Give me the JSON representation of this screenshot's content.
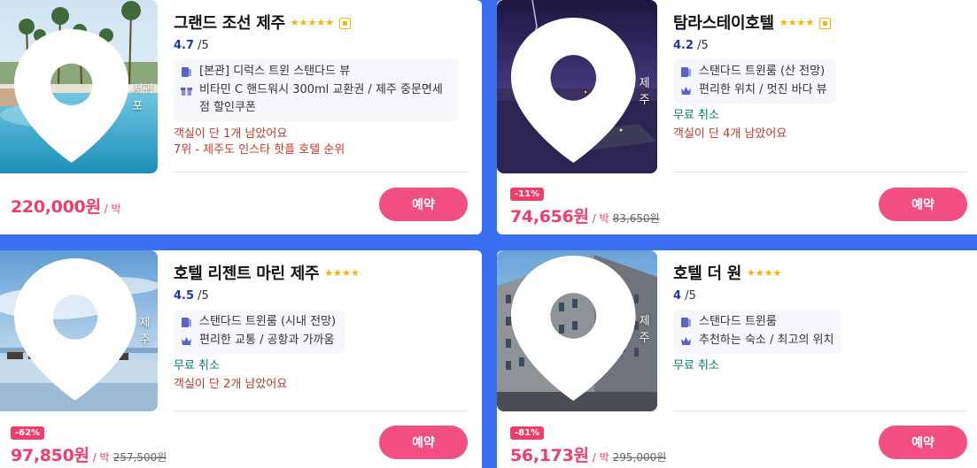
{
  "colors": {
    "accent": "#f14f82",
    "price": "#ef3e6b",
    "rating": "#1d3aa3",
    "free_cancel": "#0a7c6a",
    "warning": "#c0392b",
    "background": "#3b6ff2"
  },
  "hotels": [
    {
      "name": "그랜드 조선 제주",
      "stars": "★★★★★",
      "rating": "4.7",
      "rating_max": "/5",
      "location": "서귀포",
      "perks": [
        {
          "icon": "room-icon",
          "text": "[본관] 디럭스 트윈 스탠다드 뷰"
        },
        {
          "icon": "gift-icon",
          "text": "비타민 C 핸드워시 300ml 교환권 / 제주 중문면세점 할인쿠폰"
        }
      ],
      "free_cancel": "",
      "warnings": [
        "객실이 단 1개 남았어요",
        "7위 - 제주도 인스타 핫플 호텔 순위"
      ],
      "discount": "",
      "price": "220,000원",
      "per_night": "/ 박",
      "original_price": "",
      "book_label": "예약"
    },
    {
      "name": "탐라스테이호텔",
      "stars": "★★★★",
      "rating": "4.2",
      "rating_max": "/5",
      "location": "제주",
      "perks": [
        {
          "icon": "room-icon",
          "text": "스탠다드 트윈룸 (산 전망)"
        },
        {
          "icon": "crown-icon",
          "text": "편리한 위치 / 멋진 바다 뷰"
        }
      ],
      "free_cancel": "무료 취소",
      "warnings": [
        "객실이 단 4개 남았어요"
      ],
      "discount": "-11%",
      "price": "74,656원",
      "per_night": "/ 박",
      "original_price": "83,650원",
      "book_label": "예약"
    },
    {
      "name": "호텔 리젠트 마린 제주",
      "stars": "★★★★",
      "rating": "4.5",
      "rating_max": "/5",
      "location": "제주",
      "perks": [
        {
          "icon": "room-icon",
          "text": "스탠다드 트윈룸 (시내 전망)"
        },
        {
          "icon": "crown-icon",
          "text": "편리한 교통 / 공항과 가까움"
        }
      ],
      "free_cancel": "무료 취소",
      "warnings": [
        "객실이 단 2개 남았어요"
      ],
      "discount": "-62%",
      "price": "97,850원",
      "per_night": "/ 박",
      "original_price": "257,500원",
      "book_label": "예약"
    },
    {
      "name": "호텔 더 원",
      "stars": "★★★★",
      "rating": "4",
      "rating_max": "/5",
      "location": "제주",
      "perks": [
        {
          "icon": "room-icon",
          "text": "스탠다드 트윈룸"
        },
        {
          "icon": "crown-icon",
          "text": "추천하는 숙소 / 최고의 위치"
        }
      ],
      "free_cancel": "무료 취소",
      "warnings": [],
      "discount": "-81%",
      "price": "56,173원",
      "per_night": "/ 박",
      "original_price": "295,000원",
      "book_label": "예약"
    }
  ]
}
